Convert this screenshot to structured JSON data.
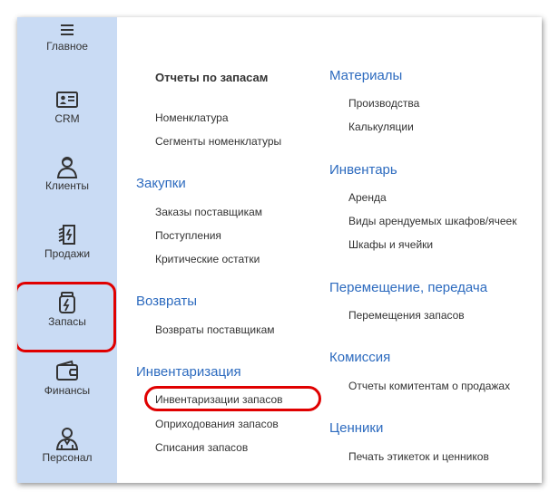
{
  "sidebar": {
    "items": [
      {
        "label": "Главное",
        "icon": "menu-icon"
      },
      {
        "label": "CRM",
        "icon": "contact-card-icon"
      },
      {
        "label": "Клиенты",
        "icon": "person-icon"
      },
      {
        "label": "Продажи",
        "icon": "sales-tag-icon"
      },
      {
        "label": "Запасы",
        "icon": "stock-jar-icon",
        "selected": true
      },
      {
        "label": "Финансы",
        "icon": "wallet-icon"
      },
      {
        "label": "Персонал",
        "icon": "staff-icon"
      }
    ]
  },
  "left_column": {
    "header": "Отчеты по запасам",
    "header_links": [
      "Номенклатура",
      "Сегменты номенклатуры"
    ],
    "groups": [
      {
        "title": "Закупки",
        "links": [
          "Заказы поставщикам",
          "Поступления",
          "Критические остатки"
        ]
      },
      {
        "title": "Возвраты",
        "links": [
          "Возвраты поставщикам"
        ]
      },
      {
        "title": "Инвентаризация",
        "links": [
          "Инвентаризации запасов",
          "Оприходования запасов",
          "Списания запасов"
        ]
      }
    ]
  },
  "right_column": {
    "groups": [
      {
        "title": "Материалы",
        "links": [
          "Производства",
          "Калькуляции"
        ]
      },
      {
        "title": "Инвентарь",
        "links": [
          "Аренда",
          "Виды арендуемых шкафов/ячеек",
          "Шкафы и ячейки"
        ]
      },
      {
        "title": "Перемещение, передача",
        "links": [
          "Перемещения запасов"
        ]
      },
      {
        "title": "Комиссия",
        "links": [
          "Отчеты комитентам о продажах"
        ]
      },
      {
        "title": "Ценники",
        "links": [
          "Печать этикеток и ценников"
        ]
      }
    ]
  },
  "colors": {
    "sidebar_bg": "#c9dbf4",
    "group_title": "#2d6bbf",
    "highlight": "#e00000"
  }
}
